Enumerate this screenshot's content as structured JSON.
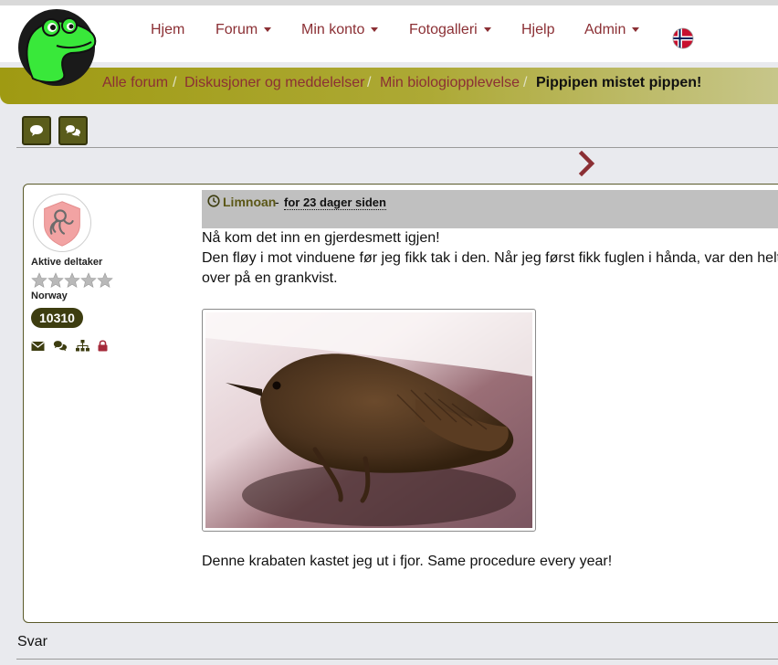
{
  "nav": {
    "items": [
      {
        "label": "Hjem",
        "dropdown": false
      },
      {
        "label": "Forum",
        "dropdown": true
      },
      {
        "label": "Min konto",
        "dropdown": true
      },
      {
        "label": "Fotogalleri",
        "dropdown": true
      },
      {
        "label": "Hjelp",
        "dropdown": false
      },
      {
        "label": "Admin",
        "dropdown": true
      }
    ]
  },
  "breadcrumb": {
    "items": [
      "Alle forum",
      "Diskusjoner og meddelelser",
      "Min biologiopplevelse"
    ],
    "separator": "/",
    "current": "Pippipen mistet pippen!"
  },
  "user": {
    "rank": "Aktive deltaker",
    "country": "Norway",
    "post_count": "10310",
    "stars": 5
  },
  "post": {
    "author": "Limnoan",
    "dash": "-",
    "time": "for 23 dager siden",
    "lines": [
      "Nå kom det inn en gjerdesmett igjen!",
      "Den fløy i mot vinduene før jeg fikk tak i den. Når jeg først fikk fuglen i hånda, var den helt s",
      "over på en grankvist."
    ],
    "caption": "Denne krabaten kastet jeg ut i fjor. Same procedure every year!"
  },
  "footer": {
    "reply_label": "Svar"
  },
  "colors": {
    "accent": "#8b2f34",
    "olive": "#5a5c1b",
    "header_gray": "#c0c0c0"
  }
}
